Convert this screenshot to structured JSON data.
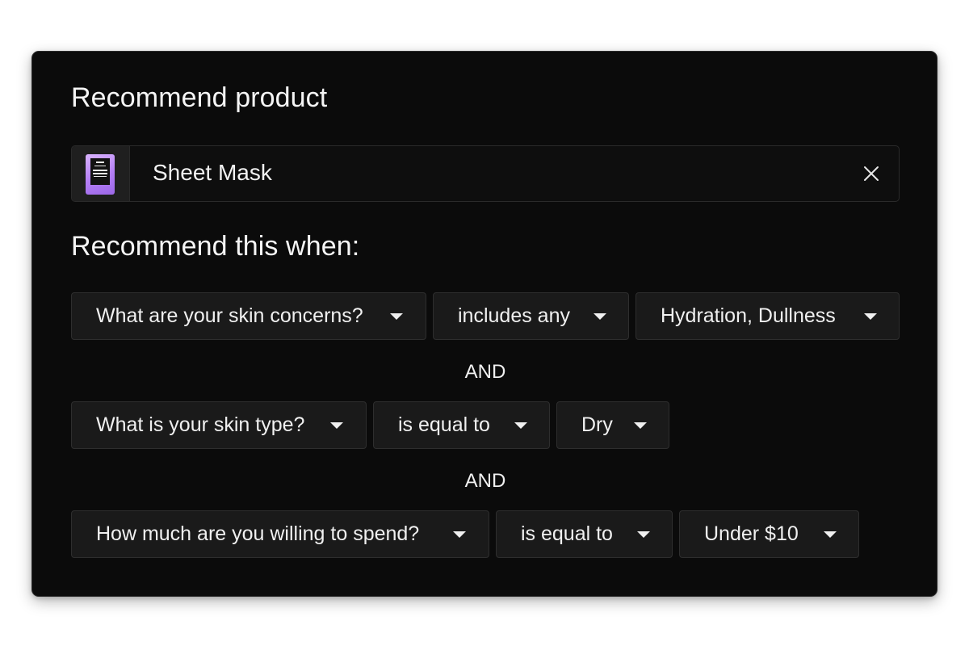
{
  "recommend_section": {
    "title": "Recommend product",
    "product": {
      "name": "Sheet Mask",
      "thumbnail_icon": "sheet-mask-package",
      "remove_icon": "close-icon"
    }
  },
  "conditions_section": {
    "title": "Recommend this when:",
    "connector": "AND",
    "rules": [
      {
        "question": "What are your skin concerns?",
        "operator": "includes any",
        "value": "Hydration, Dullness"
      },
      {
        "question": "What is your skin type?",
        "operator": "is equal to",
        "value": "Dry"
      },
      {
        "question": "How much are you willing to spend?",
        "operator": "is equal to",
        "value": "Under $10"
      }
    ]
  },
  "colors": {
    "panel_background": "#0b0b0b",
    "dropdown_background": "#1a1a1a",
    "text": "#f0f0f0",
    "thumbnail_accent": "#b47ef5"
  }
}
